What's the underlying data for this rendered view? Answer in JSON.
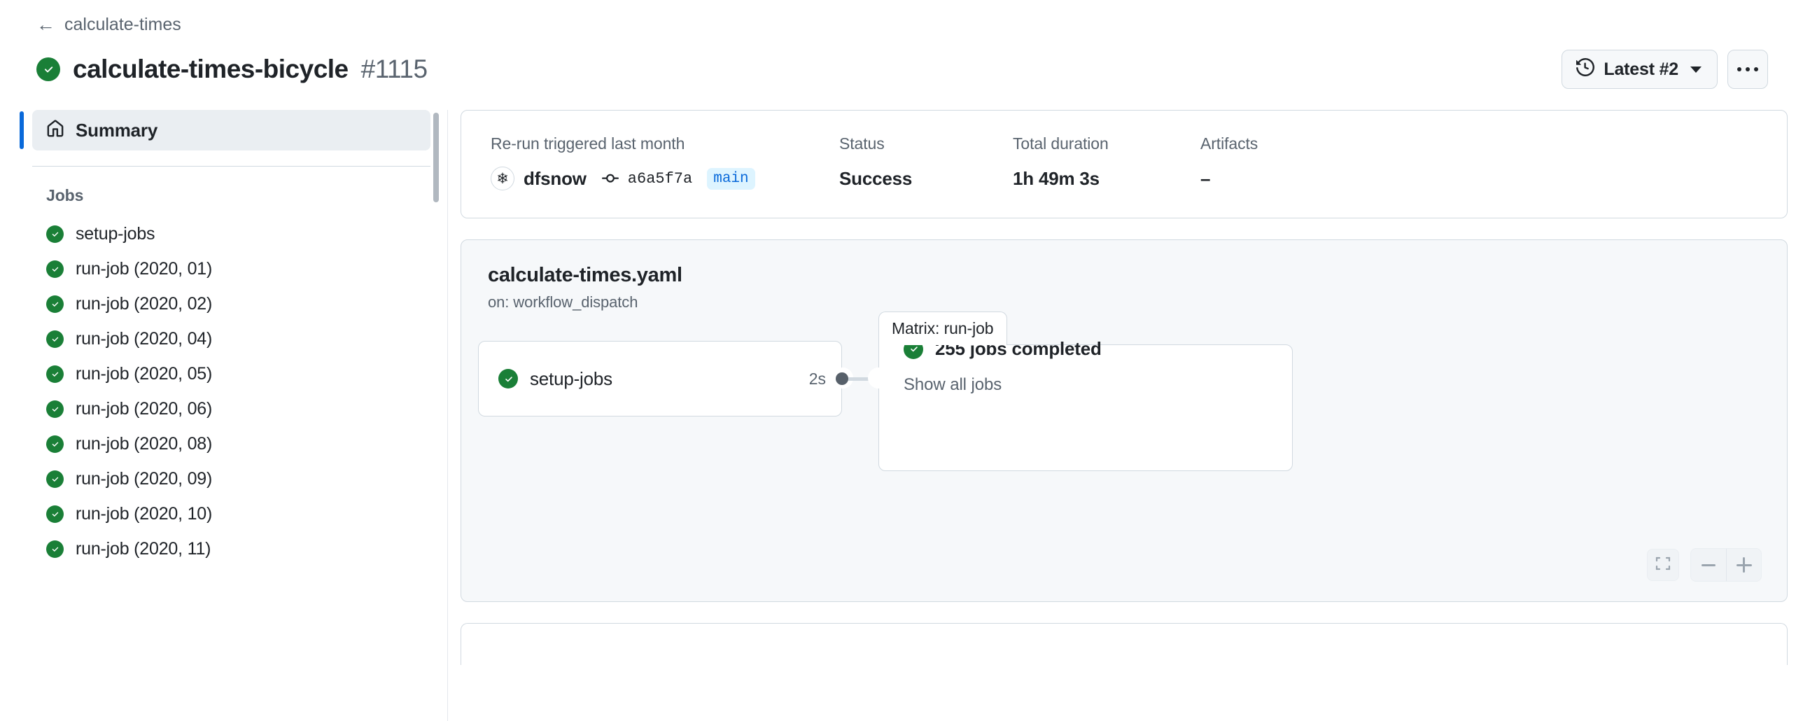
{
  "header": {
    "breadcrumb_back_icon": "arrow-left-icon",
    "breadcrumb_label": "calculate-times",
    "status_icon": "check-circle-icon",
    "run_title": "calculate-times-bicycle",
    "run_number": "#1115",
    "latest_button": {
      "icon": "history-icon",
      "label": "Latest #2",
      "caret_icon": "chevron-down-icon"
    },
    "kebab_button": {
      "icon": "kebab-horizontal-icon",
      "label": "..."
    }
  },
  "sidebar": {
    "summary": {
      "icon": "home-icon",
      "label": "Summary",
      "selected": true
    },
    "jobs_heading": "Jobs",
    "jobs": [
      {
        "label": "setup-jobs",
        "status_icon": "check-circle-icon"
      },
      {
        "label": "run-job (2020, 01)",
        "status_icon": "check-circle-icon"
      },
      {
        "label": "run-job (2020, 02)",
        "status_icon": "check-circle-icon"
      },
      {
        "label": "run-job (2020, 04)",
        "status_icon": "check-circle-icon"
      },
      {
        "label": "run-job (2020, 05)",
        "status_icon": "check-circle-icon"
      },
      {
        "label": "run-job (2020, 06)",
        "status_icon": "check-circle-icon"
      },
      {
        "label": "run-job (2020, 08)",
        "status_icon": "check-circle-icon"
      },
      {
        "label": "run-job (2020, 09)",
        "status_icon": "check-circle-icon"
      },
      {
        "label": "run-job (2020, 10)",
        "status_icon": "check-circle-icon"
      },
      {
        "label": "run-job (2020, 11)",
        "status_icon": "check-circle-icon"
      }
    ]
  },
  "summary_card": {
    "trigger_label": "Re-run triggered last month",
    "actor_avatar_icon": "snowflake-avatar-icon",
    "actor_name": "dfsnow",
    "commit_icon": "git-commit-icon",
    "commit_sha": "a6a5f7a",
    "branch": "main",
    "status_label": "Status",
    "status_value": "Success",
    "duration_label": "Total duration",
    "duration_value": "1h 49m 3s",
    "artifacts_label": "Artifacts",
    "artifacts_value": "–"
  },
  "graph_card": {
    "workflow_file": "calculate-times.yaml",
    "workflow_trigger": "on: workflow_dispatch",
    "setup_node": {
      "status_icon": "check-circle-icon",
      "label": "setup-jobs",
      "duration": "2s"
    },
    "matrix_group": {
      "tab_label": "Matrix: run-job",
      "status_icon": "check-circle-icon",
      "completed_label": "255 jobs completed",
      "show_all_label": "Show all jobs"
    },
    "controls": {
      "fullscreen_icon": "fullscreen-icon",
      "zoom_out_icon": "minus-icon",
      "zoom_in_icon": "plus-icon"
    }
  },
  "colors": {
    "success_green": "#1a7f37",
    "accent_blue": "#0969da",
    "branch_badge_bg": "#ddf4ff",
    "border": "#d1d9e0",
    "muted_text": "#59636e",
    "canvas_bg": "#f6f8fa"
  }
}
